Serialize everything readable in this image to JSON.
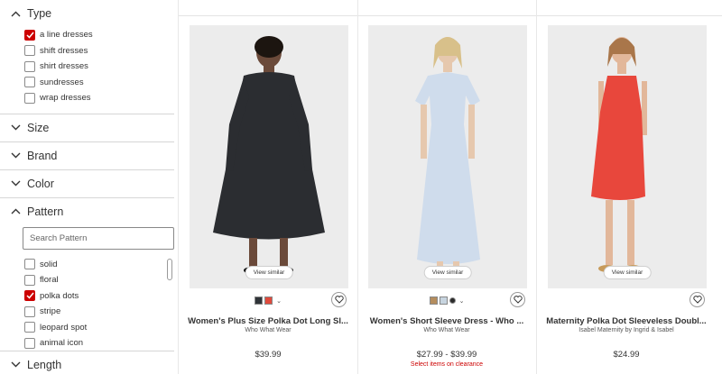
{
  "filters": {
    "type": {
      "title": "Type",
      "options": [
        {
          "label": "a line dresses",
          "checked": true
        },
        {
          "label": "shift dresses",
          "checked": false
        },
        {
          "label": "shirt dresses",
          "checked": false
        },
        {
          "label": "sundresses",
          "checked": false
        },
        {
          "label": "wrap dresses",
          "checked": false
        }
      ]
    },
    "size": {
      "title": "Size"
    },
    "brand": {
      "title": "Brand"
    },
    "color": {
      "title": "Color"
    },
    "pattern": {
      "title": "Pattern",
      "search_placeholder": "Search Pattern",
      "options": [
        {
          "label": "solid",
          "checked": false
        },
        {
          "label": "floral",
          "checked": false
        },
        {
          "label": "polka dots",
          "checked": true
        },
        {
          "label": "stripe",
          "checked": false
        },
        {
          "label": "leopard spot",
          "checked": false
        },
        {
          "label": "animal icon",
          "checked": false
        }
      ]
    },
    "length": {
      "title": "Length"
    }
  },
  "products": [
    {
      "title": "Women's Plus Size Polka Dot Long Sl...",
      "brand": "Who What Wear",
      "price": "$39.99",
      "view_similar": "View similar",
      "swatches": [
        "#2f3338",
        "#e04a3c"
      ],
      "dress_color": "#2b2d31"
    },
    {
      "title": "Women's Short Sleeve Dress - Who ...",
      "brand": "Who What Wear",
      "price": "$27.99 - $39.99",
      "clearance": "Select items on clearance",
      "view_similar": "View similar",
      "swatches": [
        "#b48d5e",
        "#c7d4df",
        "#2a2a2a"
      ],
      "dress_color": "#cfdcec"
    },
    {
      "title": "Maternity Polka Dot Sleeveless Doubl...",
      "brand": "Isabel Maternity by Ingrid & Isabel",
      "price": "$24.99",
      "view_similar": "View similar",
      "swatches": [],
      "dress_color": "#e8473c"
    }
  ],
  "colors": {
    "accent": "#cc0000"
  }
}
